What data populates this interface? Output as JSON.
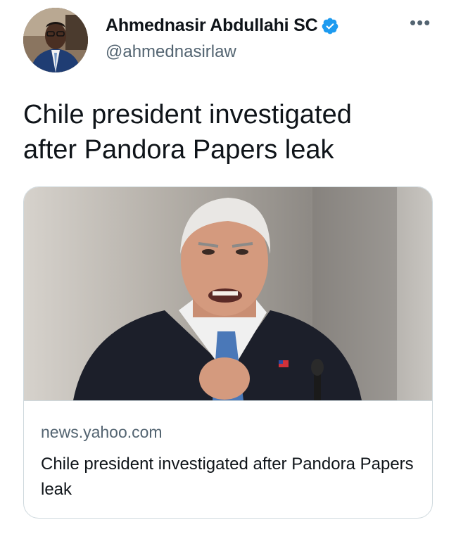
{
  "author": {
    "display_name": "Ahmednasir Abdullahi SC",
    "handle": "@ahmednasirlaw",
    "verified": true
  },
  "more_label": "•••",
  "tweet": {
    "text_line1": "Chile president investigated",
    "text_line2": "after Pandora Papers leak"
  },
  "link_card": {
    "domain": "news.yahoo.com",
    "title": "Chile president investigated after Pandora Papers leak"
  },
  "colors": {
    "verified_badge": "#1d9bf0",
    "secondary_text": "#536471",
    "card_border": "#cfd9de"
  }
}
